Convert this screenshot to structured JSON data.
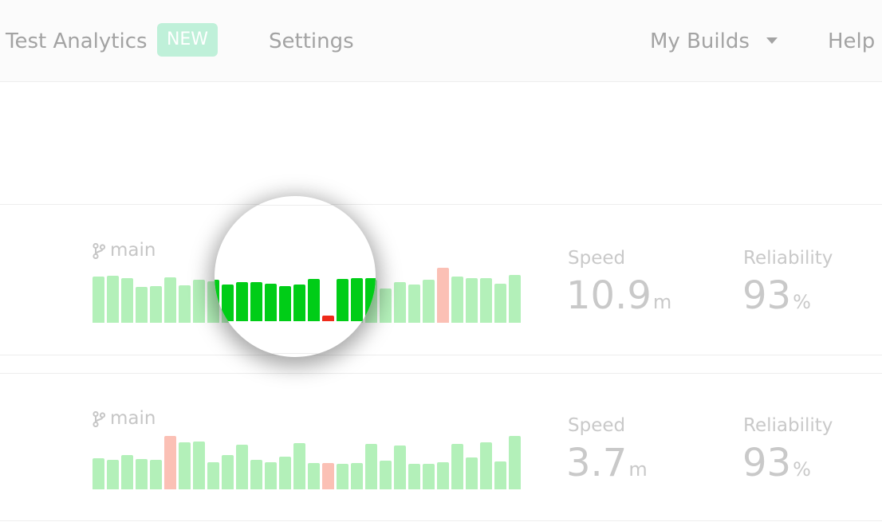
{
  "nav": {
    "test_analytics": "Test Analytics",
    "badge": "NEW",
    "settings": "Settings",
    "my_builds": "My Builds",
    "help": "Help"
  },
  "colors": {
    "pass_light": "#b3f0b9",
    "fail_light": "#fbc0b5",
    "pass_dark": "#00cd17",
    "fail_dark": "#ee2b1b"
  },
  "cards": [
    {
      "branch_icon": "git-branch-icon",
      "branch": "main",
      "speed_label": "Speed",
      "speed_value": "10.9",
      "speed_unit": "m",
      "reliability_label": "Reliability",
      "reliability_value": "93",
      "reliability_unit": "%"
    },
    {
      "branch_icon": "git-branch-icon",
      "branch": "main",
      "speed_label": "Speed",
      "speed_value": "3.7",
      "speed_unit": "m",
      "reliability_label": "Reliability",
      "reliability_value": "93",
      "reliability_unit": "%"
    }
  ],
  "chart_data": [
    {
      "type": "bar",
      "title": "",
      "ylim": [
        0,
        70
      ],
      "values": [
        58,
        59,
        56,
        45,
        46,
        57,
        47,
        54,
        52,
        46,
        49,
        49,
        47,
        44,
        46,
        53,
        7,
        53,
        54,
        54,
        43,
        51,
        48,
        54,
        69,
        58,
        56,
        56,
        49,
        60
      ],
      "status": [
        "pass",
        "pass",
        "pass",
        "pass",
        "pass",
        "pass",
        "pass",
        "pass",
        "pass",
        "pass",
        "pass",
        "pass",
        "pass",
        "pass",
        "pass",
        "pass",
        "fail",
        "pass",
        "pass",
        "pass",
        "pass",
        "pass",
        "pass",
        "pass",
        "fail",
        "pass",
        "pass",
        "pass",
        "pass",
        "pass"
      ]
    },
    {
      "type": "bar",
      "title": "",
      "ylim": [
        0,
        70
      ],
      "values": [
        39,
        37,
        43,
        38,
        37,
        67,
        59,
        60,
        34,
        43,
        56,
        37,
        34,
        41,
        58,
        33,
        33,
        32,
        33,
        57,
        36,
        55,
        32,
        32,
        34,
        57,
        40,
        59,
        35,
        67
      ],
      "status": [
        "pass",
        "pass",
        "pass",
        "pass",
        "pass",
        "fail",
        "pass",
        "pass",
        "pass",
        "pass",
        "pass",
        "pass",
        "pass",
        "pass",
        "pass",
        "pass",
        "fail",
        "pass",
        "pass",
        "pass",
        "pass",
        "pass",
        "pass",
        "pass",
        "pass",
        "pass",
        "pass",
        "pass",
        "pass",
        "pass"
      ]
    }
  ]
}
